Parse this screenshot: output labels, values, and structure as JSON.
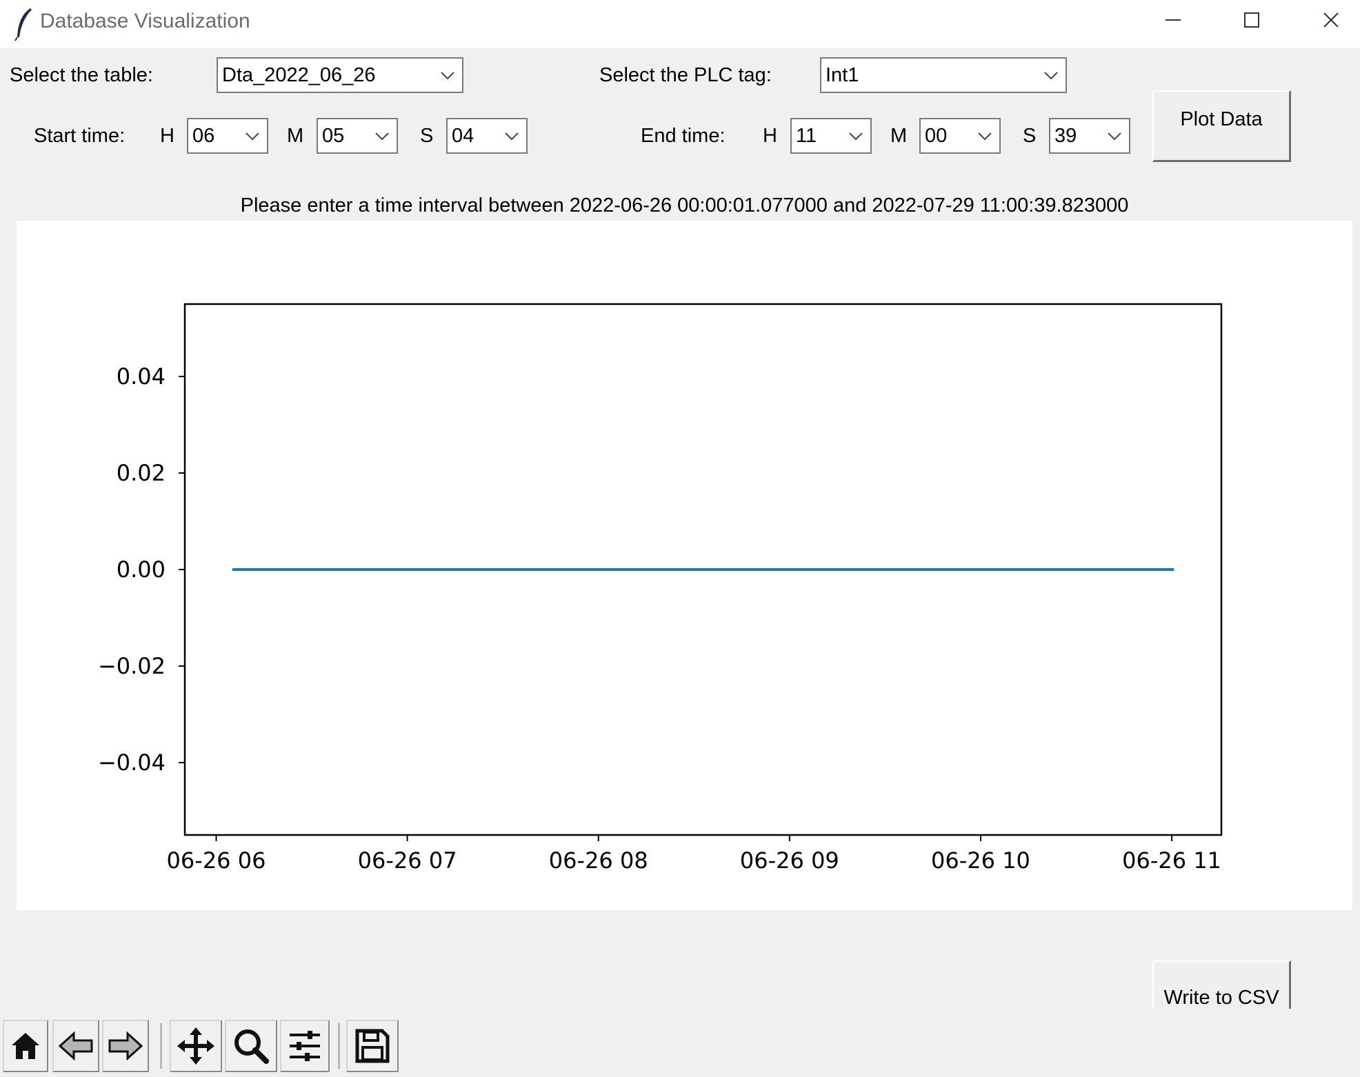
{
  "window": {
    "title": "Database Visualization",
    "icon": "feather-icon",
    "controls": [
      "minimize-icon",
      "maximize-icon",
      "close-icon"
    ]
  },
  "selectors": {
    "table_label": "Select the table:",
    "table_value": "Dta_2022_06_26",
    "tag_label": "Select the PLC tag:",
    "tag_value": "Int1"
  },
  "start_time": {
    "label": "Start time:",
    "h_label": "H",
    "h": "06",
    "m_label": "M",
    "m": "05",
    "s_label": "S",
    "s": "04"
  },
  "end_time": {
    "label": "End time:",
    "h_label": "H",
    "h": "11",
    "m_label": "M",
    "m": "00",
    "s_label": "S",
    "s": "39"
  },
  "buttons": {
    "plot": "Plot Data",
    "csv": "Write to CSV"
  },
  "info_text": "Please enter a time interval between 2022-06-26 00:00:01.077000 and 2022-07-29 11:00:39.823000",
  "toolbar": {
    "items": [
      "home-icon",
      "back-arrow-icon",
      "forward-arrow-icon",
      "pan-icon",
      "zoom-icon",
      "configure-subplots-icon",
      "save-icon"
    ]
  },
  "chart_data": {
    "type": "line",
    "title": "",
    "xlabel": "",
    "ylabel": "",
    "x_ticks": [
      "06-26 06",
      "06-26 07",
      "06-26 08",
      "06-26 09",
      "06-26 10",
      "06-26 11"
    ],
    "y_ticks": [
      "0.04",
      "0.02",
      "0.00",
      "−0.02",
      "−0.04"
    ],
    "y_tick_values": [
      0.04,
      0.02,
      0.0,
      -0.02,
      -0.04
    ],
    "ylim": [
      -0.055,
      0.055
    ],
    "xlim": [
      "2022-06-26 05:50:09",
      "2022-06-26 11:15:34"
    ],
    "series": [
      {
        "color": "#1f77b4",
        "x": [
          "2022-06-26 06:05:04",
          "2022-06-26 11:00:39"
        ],
        "y": [
          0,
          0
        ]
      }
    ],
    "grid": false
  }
}
